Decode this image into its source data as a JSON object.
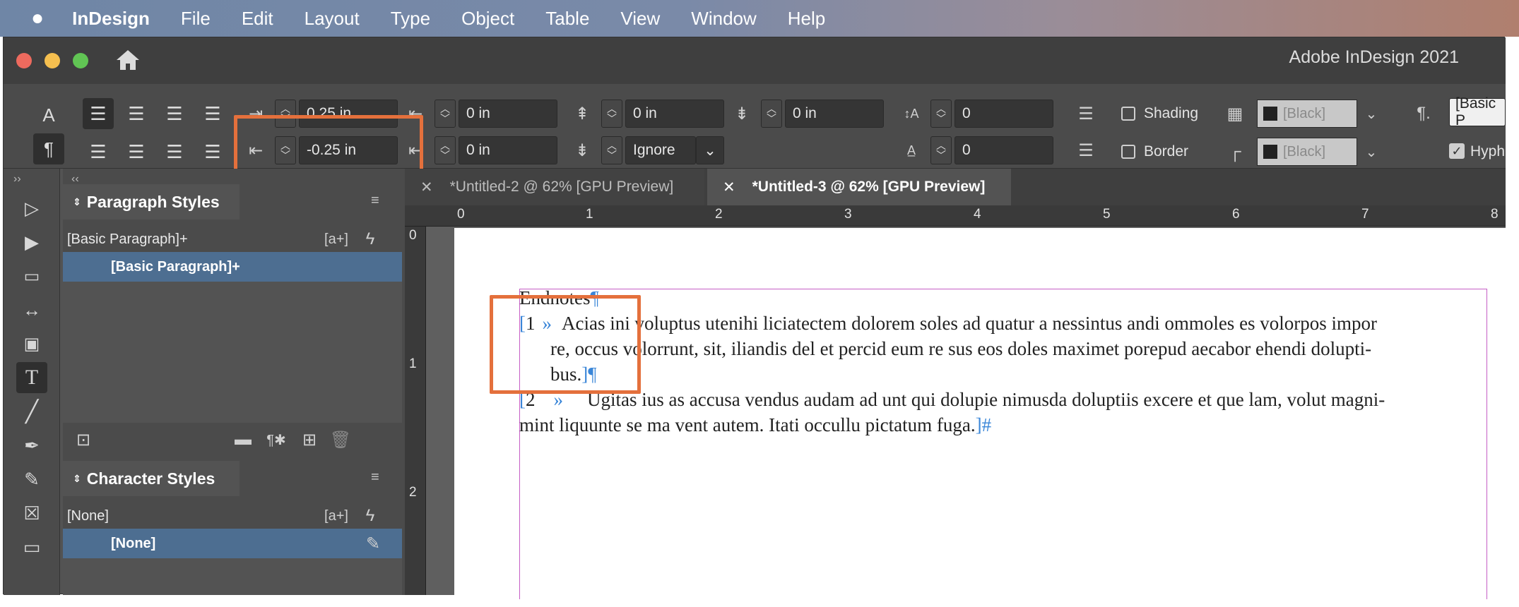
{
  "menubar": {
    "apple_icon": "apple-logo",
    "app_name": "InDesign",
    "items": [
      "File",
      "Edit",
      "Layout",
      "Type",
      "Object",
      "Table",
      "View",
      "Window",
      "Help"
    ]
  },
  "window": {
    "title": "Adobe InDesign 2021"
  },
  "control_panel": {
    "left_indent": "0.25 in",
    "first_line_indent": "-0.25 in",
    "right_indent": "0 in",
    "last_line_right_indent": "0 in",
    "space_before": "0 in",
    "space_after": "0 in",
    "space_before_2": "0 in",
    "drop_cap_lines": "0",
    "drop_cap_chars": "0",
    "align_to_grid": "Ignore",
    "shading_label": "Shading",
    "border_label": "Border",
    "shading_color": "[Black]",
    "border_color": "[Black]",
    "paragraph_style": "[Basic P",
    "hyphenate_label": "Hyph"
  },
  "panels": {
    "paragraph_styles": {
      "title": "Paragraph Styles",
      "current": "[Basic Paragraph]+",
      "items": [
        "[Basic Paragraph]+"
      ]
    },
    "character_styles": {
      "title": "Character Styles",
      "current": "[None]",
      "items": [
        "[None]"
      ]
    }
  },
  "doc_tabs": [
    {
      "label": "*Untitled-2 @ 62% [GPU Preview]",
      "active": false
    },
    {
      "label": "*Untitled-3 @ 62% [GPU Preview]",
      "active": true
    }
  ],
  "rulers": {
    "horizontal": [
      "0",
      "1",
      "2",
      "3",
      "4",
      "5",
      "6",
      "7",
      "8"
    ],
    "vertical": [
      "0",
      "1",
      "2"
    ]
  },
  "document": {
    "heading": "Endnotes",
    "endnote1": {
      "number": "1",
      "line1": "Acias ini voluptus utenihi liciatectem dolorem soles ad quatur a nessintus andi ommoles es volorpos impor",
      "line2": "re, occus volorrunt, sit, iliandis del et percid eum re sus eos doles maximet porepud aecabor ehendi dolupti-",
      "line3": "bus."
    },
    "endnote2": {
      "number": "2",
      "line1": "Ugitas ius as accusa vendus audam ad unt qui dolupie nimusda doluptiis excere et que lam, volut magni-",
      "line2": "mint liquunte se ma vent autem. Itati occullu pictatum fuga."
    }
  },
  "colors": {
    "selection": "#4d6e91",
    "highlight": "#e4703c",
    "frame": "#c55ec5"
  }
}
